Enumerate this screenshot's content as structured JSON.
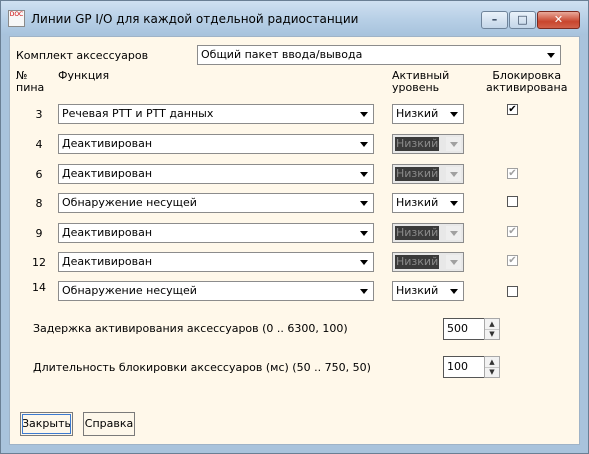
{
  "window": {
    "title": "Линии GP I/O для каждой отдельной радиостанции",
    "icon_text": "DOC",
    "minimize_glyph": "–",
    "maximize_glyph": "□",
    "close_glyph": "✕"
  },
  "kit": {
    "label": "Комплект аксессуаров",
    "value": "Общий пакет ввода/вывода"
  },
  "headers": {
    "pin_line1": "№",
    "pin_line2": "пина",
    "function": "Функция",
    "active_line1": "Активный",
    "active_line2": "уровень",
    "lock_line1": "Блокировка",
    "lock_line2": "активирована"
  },
  "rows": [
    {
      "pin": "3",
      "function": "Речевая PTT и PTT данных",
      "level": "Низкий",
      "level_disabled": false,
      "lock_checked": true,
      "lock_disabled": false,
      "lock_mark": "✔"
    },
    {
      "pin": "4",
      "function": "Деактивирован",
      "level": "Низкий",
      "level_disabled": true,
      "lock_checked": null,
      "lock_disabled": true,
      "lock_mark": ""
    },
    {
      "pin": "6",
      "function": "Деактивирован",
      "level": "Низкий",
      "level_disabled": true,
      "lock_checked": true,
      "lock_disabled": true,
      "lock_mark": "✔"
    },
    {
      "pin": "8",
      "function": "Обнаружение несущей",
      "level": "Низкий",
      "level_disabled": false,
      "lock_checked": false,
      "lock_disabled": false,
      "lock_mark": ""
    },
    {
      "pin": "9",
      "function": "Деактивирован",
      "level": "Низкий",
      "level_disabled": true,
      "lock_checked": true,
      "lock_disabled": true,
      "lock_mark": "✔"
    },
    {
      "pin": "12",
      "function": "Деактивирован",
      "level": "Низкий",
      "level_disabled": true,
      "lock_checked": true,
      "lock_disabled": true,
      "lock_mark": "✔"
    },
    {
      "pin": "14",
      "function": "Обнаружение несущей",
      "level": "Низкий",
      "level_disabled": false,
      "lock_checked": false,
      "lock_disabled": false,
      "lock_mark": ""
    }
  ],
  "delay": {
    "label": "Задержка активирования аксессуаров (0 .. 6300, 100)",
    "value": "500"
  },
  "lock_duration": {
    "label": "Длительность блокировки аксессуаров (мс) (50 .. 750, 50)",
    "value": "100"
  },
  "spin": {
    "up": "▲",
    "down": "▼"
  },
  "buttons": {
    "close": "Закрыть",
    "help": "Справка"
  }
}
